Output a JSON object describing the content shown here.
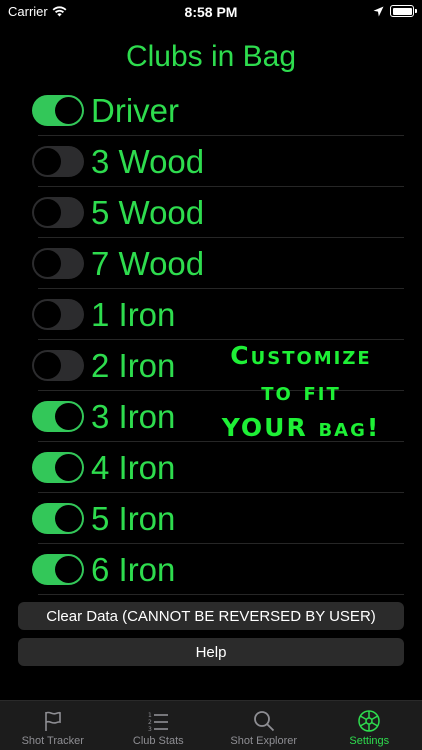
{
  "status_bar": {
    "carrier": "Carrier",
    "time": "8:58 PM"
  },
  "page": {
    "title": "Clubs in Bag"
  },
  "clubs": [
    {
      "label": "Driver",
      "enabled": true
    },
    {
      "label": "3 Wood",
      "enabled": false
    },
    {
      "label": "5 Wood",
      "enabled": false
    },
    {
      "label": "7 Wood",
      "enabled": false
    },
    {
      "label": "1 Iron",
      "enabled": false
    },
    {
      "label": "2 Iron",
      "enabled": false
    },
    {
      "label": "3 Iron",
      "enabled": true
    },
    {
      "label": "4 Iron",
      "enabled": true
    },
    {
      "label": "5 Iron",
      "enabled": true
    },
    {
      "label": "6 Iron",
      "enabled": true
    }
  ],
  "promo": {
    "line1": "Customize",
    "line2": "to fit",
    "line3": "YOUR bag!"
  },
  "buttons": {
    "clear_data": "Clear Data (CANNOT BE REVERSED BY USER)",
    "help": "Help"
  },
  "tabs": [
    {
      "label": "Shot Tracker",
      "icon": "flag-icon",
      "active": false
    },
    {
      "label": "Club Stats",
      "icon": "list-icon",
      "active": false
    },
    {
      "label": "Shot Explorer",
      "icon": "search-icon",
      "active": false
    },
    {
      "label": "Settings",
      "icon": "gear-icon",
      "active": true
    }
  ],
  "colors": {
    "accent_green": "#2edc4e",
    "toggle_on": "#33c759",
    "toggle_off": "#2c2c2e",
    "background": "#000000"
  }
}
